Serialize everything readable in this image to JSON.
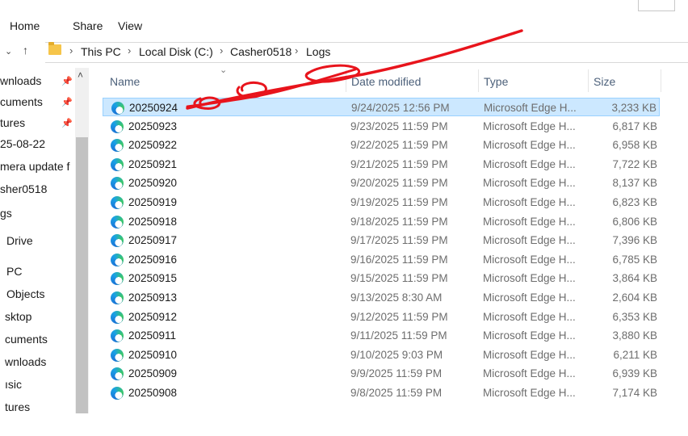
{
  "ribbon": {
    "tabs": [
      "Home",
      "Share",
      "View"
    ]
  },
  "address": {
    "crumbs": [
      "This PC",
      "Local Disk (C:)",
      "Casher0518",
      "Logs"
    ],
    "separator": "›"
  },
  "nav": {
    "items": [
      "wnloads",
      "cuments",
      "tures",
      "25-08-22",
      "mera update f",
      "sher0518",
      "gs",
      "Drive",
      "PC",
      "Objects",
      "sktop",
      "cuments",
      "wnloads",
      "ısic",
      "tures"
    ]
  },
  "columns": {
    "name": "Name",
    "date": "Date modified",
    "type": "Type",
    "size": "Size"
  },
  "files": [
    {
      "name": "20250924",
      "date": "9/24/2025 12:56 PM",
      "type": "Microsoft Edge H...",
      "size": "3,233 KB",
      "selected": true
    },
    {
      "name": "20250923",
      "date": "9/23/2025 11:59 PM",
      "type": "Microsoft Edge H...",
      "size": "6,817 KB"
    },
    {
      "name": "20250922",
      "date": "9/22/2025 11:59 PM",
      "type": "Microsoft Edge H...",
      "size": "6,958 KB"
    },
    {
      "name": "20250921",
      "date": "9/21/2025 11:59 PM",
      "type": "Microsoft Edge H...",
      "size": "7,722 KB"
    },
    {
      "name": "20250920",
      "date": "9/20/2025 11:59 PM",
      "type": "Microsoft Edge H...",
      "size": "8,137 KB"
    },
    {
      "name": "20250919",
      "date": "9/19/2025 11:59 PM",
      "type": "Microsoft Edge H...",
      "size": "6,823 KB"
    },
    {
      "name": "20250918",
      "date": "9/18/2025 11:59 PM",
      "type": "Microsoft Edge H...",
      "size": "6,806 KB"
    },
    {
      "name": "20250917",
      "date": "9/17/2025 11:59 PM",
      "type": "Microsoft Edge H...",
      "size": "7,396 KB"
    },
    {
      "name": "20250916",
      "date": "9/16/2025 11:59 PM",
      "type": "Microsoft Edge H...",
      "size": "6,785 KB"
    },
    {
      "name": "20250915",
      "date": "9/15/2025 11:59 PM",
      "type": "Microsoft Edge H...",
      "size": "3,864 KB"
    },
    {
      "name": "20250913",
      "date": "9/13/2025 8:30 AM",
      "type": "Microsoft Edge H...",
      "size": "2,604 KB"
    },
    {
      "name": "20250912",
      "date": "9/12/2025 11:59 PM",
      "type": "Microsoft Edge H...",
      "size": "6,353 KB"
    },
    {
      "name": "20250911",
      "date": "9/11/2025 11:59 PM",
      "type": "Microsoft Edge H...",
      "size": "3,880 KB"
    },
    {
      "name": "20250910",
      "date": "9/10/2025 9:03 PM",
      "type": "Microsoft Edge H...",
      "size": "6,211 KB"
    },
    {
      "name": "20250909",
      "date": "9/9/2025 11:59 PM",
      "type": "Microsoft Edge H...",
      "size": "6,939 KB"
    },
    {
      "name": "20250908",
      "date": "9/8/2025 11:59 PM",
      "type": "Microsoft Edge H...",
      "size": "7,174 KB"
    }
  ],
  "icons": {
    "file": "edge-html-icon",
    "folder": "folder-icon",
    "up": "up-arrow-icon",
    "pin": "pin-icon"
  },
  "colors": {
    "selection": "#cce8ff",
    "selection_border": "#99d1ff",
    "annotation": "#e8141c",
    "header_text": "#4c607a"
  }
}
